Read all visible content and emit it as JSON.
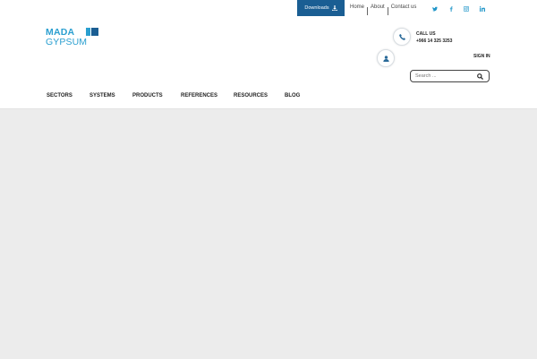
{
  "topbar": {
    "downloads_label": "Downloads",
    "links": [
      "Home",
      "About",
      "Contact us"
    ],
    "social": [
      "twitter-icon",
      "facebook-icon",
      "instagram-icon",
      "linkedin-icon"
    ]
  },
  "logo": {
    "line1": "MADA",
    "line2": "GYPSUM"
  },
  "contact": {
    "call_label": "CALL US",
    "call_number": "+966 14 325 3253",
    "signin_label": "SIGN IN"
  },
  "search": {
    "placeholder": "Search ..."
  },
  "nav": {
    "items": [
      "SECTORS",
      "SYSTEMS",
      "PRODUCTS",
      "REFERENCES",
      "RESOURCES",
      "BLOG"
    ]
  },
  "colors": {
    "brand": "#2a9fd0",
    "downloads_bg": "#1a5e93",
    "content_bg": "#ececec"
  }
}
